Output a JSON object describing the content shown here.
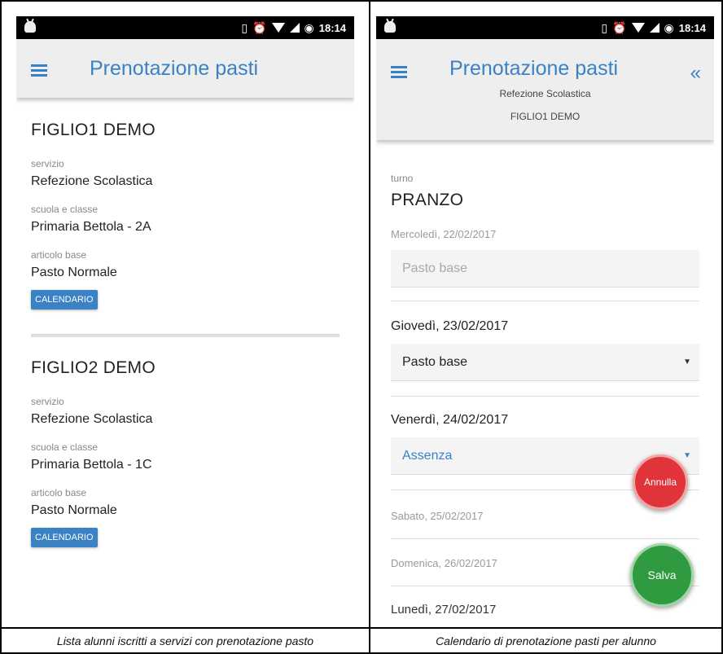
{
  "left": {
    "status": {
      "time": "18:14"
    },
    "appbar": {
      "title": "Prenotazione pasti"
    },
    "students": [
      {
        "name": "FIGLIO1 DEMO",
        "servizio_label": "servizio",
        "servizio": "Refezione Scolastica",
        "scuola_label": "scuola e classe",
        "scuola": "Primaria Bettola - 2A",
        "articolo_label": "articolo base",
        "articolo": "Pasto Normale",
        "button": "CALENDARIO"
      },
      {
        "name": "FIGLIO2 DEMO",
        "servizio_label": "servizio",
        "servizio": "Refezione Scolastica",
        "scuola_label": "scuola e classe",
        "scuola": "Primaria Bettola - 1C",
        "articolo_label": "articolo base",
        "articolo": "Pasto Normale",
        "button": "CALENDARIO"
      }
    ],
    "caption": "Lista alunni iscritti a servizi con prenotazione pasto"
  },
  "right": {
    "status": {
      "time": "18:14"
    },
    "appbar": {
      "title": "Prenotazione pasti",
      "service": "Refezione Scolastica",
      "child": "FIGLIO1 DEMO",
      "back": "«"
    },
    "turno_label": "turno",
    "turno": "PRANZO",
    "days": [
      {
        "date": "Mercoledì, 22/02/2017",
        "value": "Pasto base"
      },
      {
        "date": "Giovedì, 23/02/2017",
        "value": "Pasto base"
      },
      {
        "date": "Venerdì, 24/02/2017",
        "value": "Assenza"
      },
      {
        "date": "Sabato, 25/02/2017"
      },
      {
        "date": "Domenica, 26/02/2017"
      },
      {
        "date": "Lunedì, 27/02/2017"
      }
    ],
    "fab_annulla": "Annulla",
    "fab_salva": "Salva",
    "caption": "Calendario di prenotazione pasti  per alunno"
  },
  "colors": {
    "accent": "#3a82c4",
    "annulla": "#e0343a",
    "salva": "#2f9a3f"
  }
}
